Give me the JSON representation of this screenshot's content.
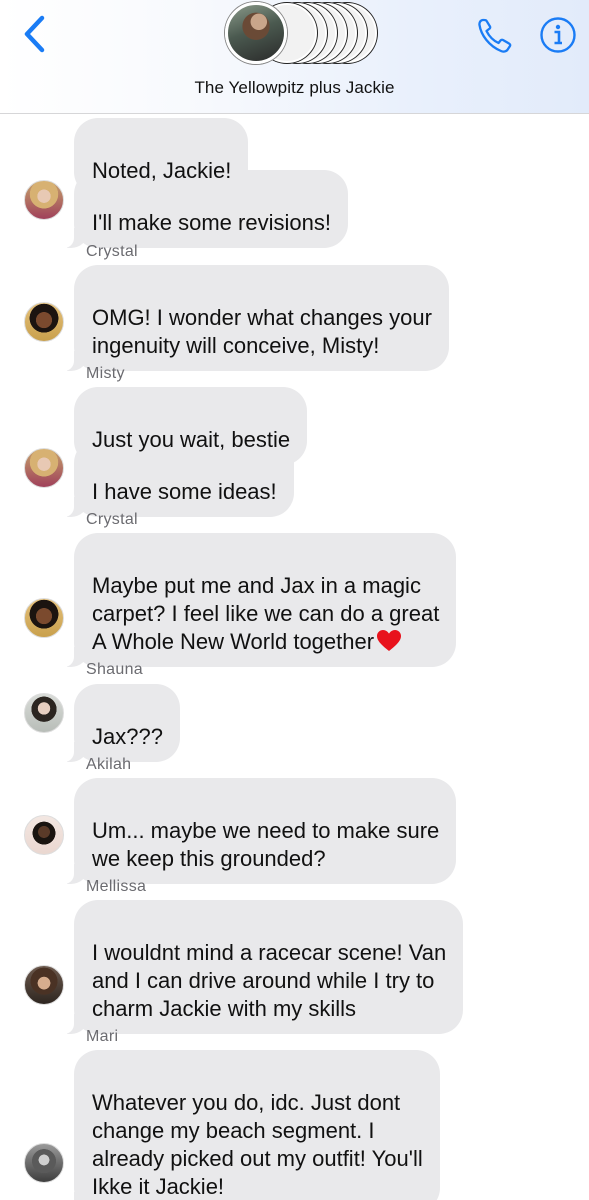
{
  "header": {
    "group_name": "The Yellowpitz plus Jackie",
    "back_icon": "chevron-left-icon",
    "call_icon": "phone-icon",
    "info_icon": "info-icon",
    "accent_color": "#1a7cf5"
  },
  "messages": [
    {
      "sender": "",
      "text": "Noted, Jackie!"
    },
    {
      "sender": "",
      "text": "I'll make some revisions!",
      "avatar": "misty"
    },
    {
      "sender": "Crystal",
      "text": "OMG! I wonder what changes your\ningenuity will conceive, Misty!",
      "avatar": "crystal"
    },
    {
      "sender": "Misty",
      "text": "Just you wait, bestie"
    },
    {
      "sender": "",
      "text": "I have some ideas!",
      "avatar": "misty"
    },
    {
      "sender": "Crystal",
      "text": "Maybe put me and Jax in a magic\ncarpet? I feel like we can do a great\nA Whole New World together",
      "emoji": "red-heart-icon",
      "avatar": "crystal"
    },
    {
      "sender": "Shauna",
      "text": "Jax???",
      "avatar": "shauna"
    },
    {
      "sender": "Akilah",
      "text": "Um... maybe we need to make sure\nwe keep this grounded?",
      "avatar": "akilah"
    },
    {
      "sender": "Mellissa",
      "text": "I wouldnt mind a racecar scene! Van\nand I can drive around while I try to\ncharm Jackie with my skills",
      "avatar": "mellissa"
    },
    {
      "sender": "Mari",
      "text": "Whatever you do, idc. Just dont\nchange my beach segment. I\nalready picked out my outfit! You'll\nIkke it Jackie!",
      "avatar": "mari"
    }
  ],
  "bubble_color": "#e9e9eb"
}
